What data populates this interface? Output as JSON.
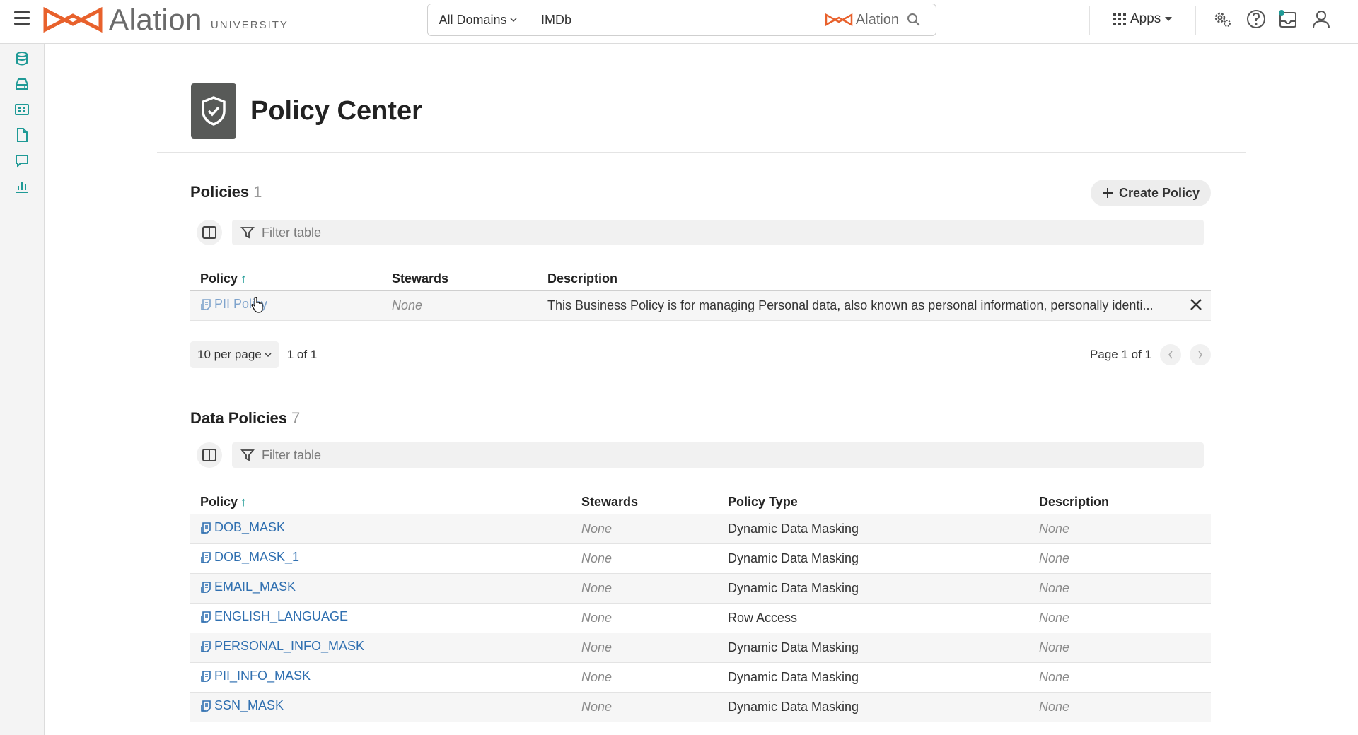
{
  "header": {
    "logo_word": "Alation",
    "logo_sub": "UNIVERSITY",
    "domains_label": "All Domains",
    "search_value": "IMDb",
    "search_brand": "Alation",
    "apps_label": "Apps"
  },
  "page": {
    "title": "Policy Center"
  },
  "policies": {
    "title": "Policies",
    "count": "1",
    "create_label": "Create Policy",
    "filter_placeholder": "Filter table",
    "columns": {
      "policy": "Policy",
      "stewards": "Stewards",
      "description": "Description"
    },
    "rows": [
      {
        "name": "PII Policy",
        "stewards": "None",
        "description": "This Business Policy is for managing Personal data, also known as personal information, personally identi..."
      }
    ],
    "per_page": "10 per page",
    "range": "1 of 1",
    "page_label": "Page 1 of 1"
  },
  "data_policies": {
    "title": "Data Policies",
    "count": "7",
    "filter_placeholder": "Filter table",
    "columns": {
      "policy": "Policy",
      "stewards": "Stewards",
      "type": "Policy Type",
      "description": "Description"
    },
    "rows": [
      {
        "name": "DOB_MASK",
        "stewards": "None",
        "type": "Dynamic Data Masking",
        "description": "None"
      },
      {
        "name": "DOB_MASK_1",
        "stewards": "None",
        "type": "Dynamic Data Masking",
        "description": "None"
      },
      {
        "name": "EMAIL_MASK",
        "stewards": "None",
        "type": "Dynamic Data Masking",
        "description": "None"
      },
      {
        "name": "ENGLISH_LANGUAGE",
        "stewards": "None",
        "type": "Row Access",
        "description": "None"
      },
      {
        "name": "PERSONAL_INFO_MASK",
        "stewards": "None",
        "type": "Dynamic Data Masking",
        "description": "None"
      },
      {
        "name": "PII_INFO_MASK",
        "stewards": "None",
        "type": "Dynamic Data Masking",
        "description": "None"
      },
      {
        "name": "SSN_MASK",
        "stewards": "None",
        "type": "Dynamic Data Masking",
        "description": "None"
      }
    ]
  },
  "colors": {
    "brand": "#e8612c",
    "link": "#2f6fb0",
    "rail_icon": "#1f9a96",
    "shield_bg": "#585a58"
  },
  "icons": [
    "menu-icon",
    "alation-logo-icon",
    "search-icon",
    "apps-grid-icon",
    "settings-icon",
    "help-icon",
    "inbox-icon",
    "user-icon",
    "database-icon",
    "storage-icon",
    "catalog-icon",
    "document-icon",
    "conversation-icon",
    "chart-icon",
    "shield-icon",
    "plus-icon",
    "columns-icon",
    "filter-icon",
    "policy-icon",
    "close-icon"
  ]
}
